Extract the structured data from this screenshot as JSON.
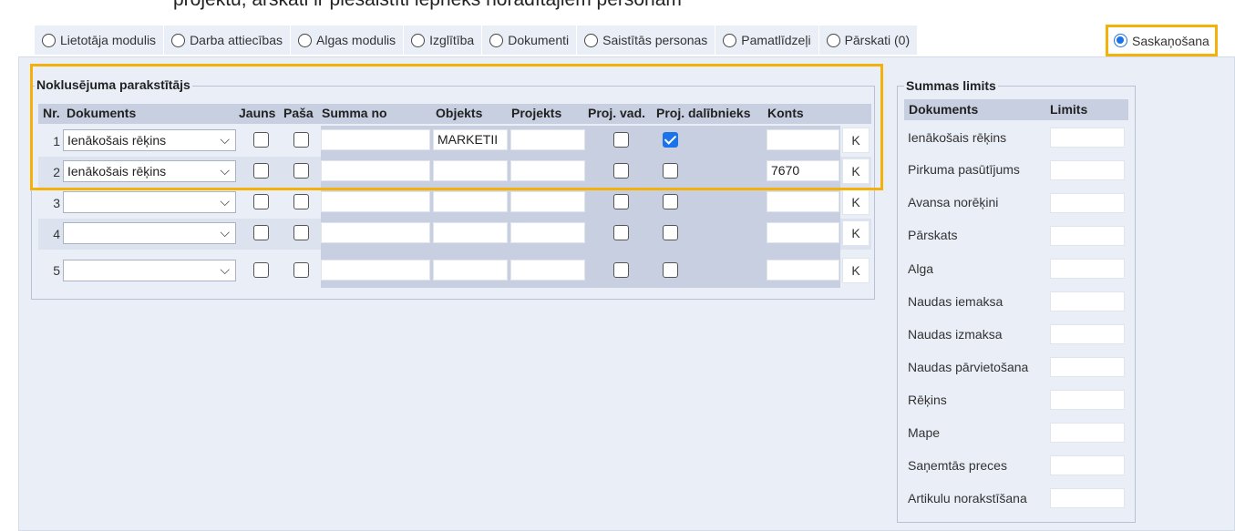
{
  "top_text": "projektu, ārskati ir piesaistīti iepriekš norādītajiem personām",
  "tabs": [
    {
      "label": "Lietotāja modulis"
    },
    {
      "label": "Darba attiecības"
    },
    {
      "label": "Algas modulis"
    },
    {
      "label": "Izglītība"
    },
    {
      "label": "Dokumenti"
    },
    {
      "label": "Saistītās personas"
    },
    {
      "label": "Pamatlīdzeļi"
    },
    {
      "label": "Pārskati (0)"
    }
  ],
  "active_tab": {
    "label": "Saskaņošana"
  },
  "signers": {
    "title": "Noklusējuma parakstītājs",
    "columns": {
      "nr": "Nr.",
      "dokuments": "Dokuments",
      "jauns": "Jauns",
      "pasa": "Paša",
      "summa_no": "Summa no",
      "objekts": "Objekts",
      "projekts": "Projekts",
      "proj_vad": "Proj. vad.",
      "proj_dalibnieks": "Proj. dalībnieks",
      "konts": "Konts"
    },
    "rows": [
      {
        "nr": "1",
        "dokuments": "Ienākošais rēķins",
        "jauns": false,
        "pasa": false,
        "summa_no": "",
        "objekts": "MARKETII",
        "projekts": "",
        "proj_vad": false,
        "proj_dalibnieks": true,
        "konts": "",
        "k": "K"
      },
      {
        "nr": "2",
        "dokuments": "Ienākošais rēķins",
        "jauns": false,
        "pasa": false,
        "summa_no": "",
        "objekts": "",
        "projekts": "",
        "proj_vad": false,
        "proj_dalibnieks": false,
        "konts": "7670",
        "k": "K"
      },
      {
        "nr": "3",
        "dokuments": "",
        "jauns": false,
        "pasa": false,
        "summa_no": "",
        "objekts": "",
        "projekts": "",
        "proj_vad": false,
        "proj_dalibnieks": false,
        "konts": "",
        "k": "K"
      },
      {
        "nr": "4",
        "dokuments": "",
        "jauns": false,
        "pasa": false,
        "summa_no": "",
        "objekts": "",
        "projekts": "",
        "proj_vad": false,
        "proj_dalibnieks": false,
        "konts": "",
        "k": "K"
      },
      {
        "nr": "5",
        "dokuments": "",
        "jauns": false,
        "pasa": false,
        "summa_no": "",
        "objekts": "",
        "projekts": "",
        "proj_vad": false,
        "proj_dalibnieks": false,
        "konts": "",
        "k": "K"
      }
    ]
  },
  "limits": {
    "title": "Summas limits",
    "col_dokuments": "Dokuments",
    "col_limits": "Limits",
    "items": [
      {
        "label": "Ienākošais rēķins"
      },
      {
        "label": "Pirkuma pasūtījums"
      },
      {
        "label": "Avansa norēķini"
      },
      {
        "label": "Pārskats"
      },
      {
        "label": "Alga"
      },
      {
        "label": "Naudas iemaksa"
      },
      {
        "label": "Naudas izmaksa"
      },
      {
        "label": "Naudas pārvietošana"
      },
      {
        "label": "Rēķins"
      },
      {
        "label": "Mape"
      },
      {
        "label": "Saņemtās preces"
      },
      {
        "label": "Artikulu norakstīšana"
      }
    ]
  },
  "colors": {
    "highlight": "#f5b10b",
    "accent": "#1a73e8",
    "panel": "#e9eef7",
    "header": "#c7cfe0"
  }
}
